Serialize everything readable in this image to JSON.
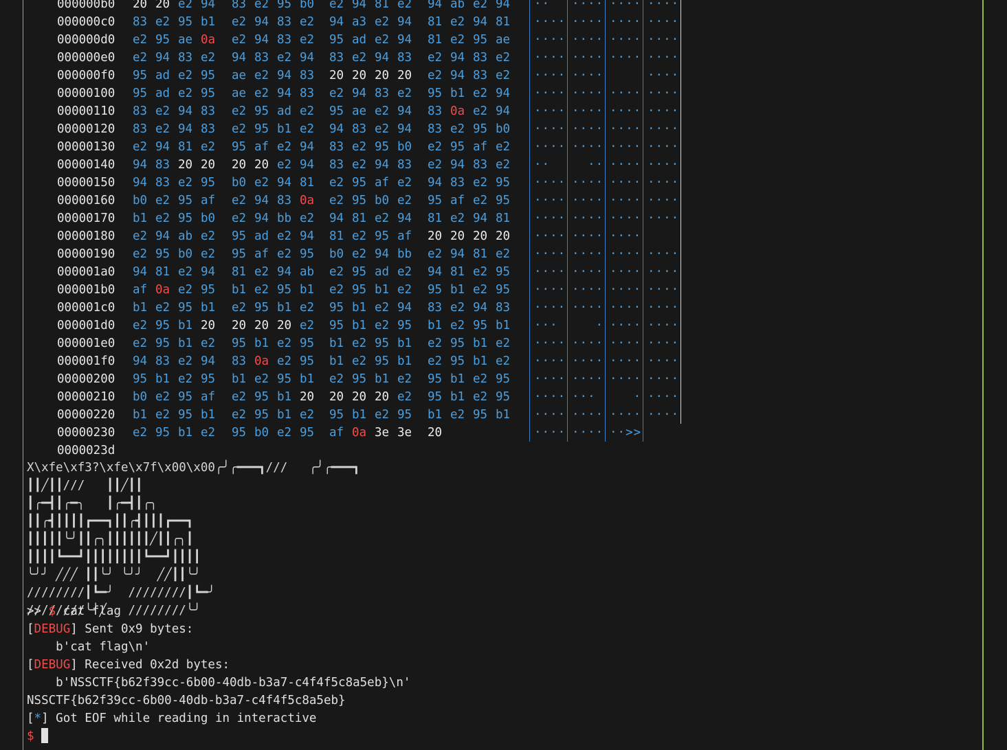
{
  "hexdump": {
    "rows": [
      {
        "offset": "000000b0",
        "bytes": [
          "20",
          "20",
          "e2",
          "94",
          "83",
          "e2",
          "95",
          "b0",
          "e2",
          "94",
          "81",
          "e2",
          "94",
          "ab",
          "e2",
          "94"
        ],
        "ascii": [
          "··",
          "····",
          "····",
          "····"
        ]
      },
      {
        "offset": "000000c0",
        "bytes": [
          "83",
          "e2",
          "95",
          "b1",
          "e2",
          "94",
          "83",
          "e2",
          "94",
          "a3",
          "e2",
          "94",
          "81",
          "e2",
          "94",
          "81"
        ],
        "ascii": [
          "····",
          "····",
          "····",
          "····"
        ]
      },
      {
        "offset": "000000d0",
        "bytes": [
          "e2",
          "95",
          "ae",
          "0a",
          "e2",
          "94",
          "83",
          "e2",
          "95",
          "ad",
          "e2",
          "94",
          "81",
          "e2",
          "95",
          "ae"
        ],
        "ascii": [
          "····",
          "····",
          "····",
          "····"
        ]
      },
      {
        "offset": "000000e0",
        "bytes": [
          "e2",
          "94",
          "83",
          "e2",
          "94",
          "83",
          "e2",
          "94",
          "83",
          "e2",
          "94",
          "83",
          "e2",
          "94",
          "83",
          "e2"
        ],
        "ascii": [
          "····",
          "····",
          "····",
          "····"
        ]
      },
      {
        "offset": "000000f0",
        "bytes": [
          "95",
          "ad",
          "e2",
          "95",
          "ae",
          "e2",
          "94",
          "83",
          "20",
          "20",
          "20",
          "20",
          "e2",
          "94",
          "83",
          "e2"
        ],
        "ascii": [
          "····",
          "····",
          "    ",
          "····"
        ]
      },
      {
        "offset": "00000100",
        "bytes": [
          "95",
          "ad",
          "e2",
          "95",
          "ae",
          "e2",
          "94",
          "83",
          "e2",
          "94",
          "83",
          "e2",
          "95",
          "b1",
          "e2",
          "94"
        ],
        "ascii": [
          "····",
          "····",
          "····",
          "····"
        ]
      },
      {
        "offset": "00000110",
        "bytes": [
          "83",
          "e2",
          "94",
          "83",
          "e2",
          "95",
          "ad",
          "e2",
          "95",
          "ae",
          "e2",
          "94",
          "83",
          "0a",
          "e2",
          "94"
        ],
        "ascii": [
          "····",
          "····",
          "····",
          "····"
        ]
      },
      {
        "offset": "00000120",
        "bytes": [
          "83",
          "e2",
          "94",
          "83",
          "e2",
          "95",
          "b1",
          "e2",
          "94",
          "83",
          "e2",
          "94",
          "83",
          "e2",
          "95",
          "b0"
        ],
        "ascii": [
          "····",
          "····",
          "····",
          "····"
        ]
      },
      {
        "offset": "00000130",
        "bytes": [
          "e2",
          "94",
          "81",
          "e2",
          "95",
          "af",
          "e2",
          "94",
          "83",
          "e2",
          "95",
          "b0",
          "e2",
          "95",
          "af",
          "e2"
        ],
        "ascii": [
          "····",
          "····",
          "····",
          "····"
        ]
      },
      {
        "offset": "00000140",
        "bytes": [
          "94",
          "83",
          "20",
          "20",
          "20",
          "20",
          "e2",
          "94",
          "83",
          "e2",
          "94",
          "83",
          "e2",
          "94",
          "83",
          "e2"
        ],
        "ascii": [
          "··  ",
          "  ··",
          "····",
          "····"
        ]
      },
      {
        "offset": "00000150",
        "bytes": [
          "94",
          "83",
          "e2",
          "95",
          "b0",
          "e2",
          "94",
          "81",
          "e2",
          "95",
          "af",
          "e2",
          "94",
          "83",
          "e2",
          "95"
        ],
        "ascii": [
          "····",
          "····",
          "····",
          "····"
        ]
      },
      {
        "offset": "00000160",
        "bytes": [
          "b0",
          "e2",
          "95",
          "af",
          "e2",
          "94",
          "83",
          "0a",
          "e2",
          "95",
          "b0",
          "e2",
          "95",
          "af",
          "e2",
          "95"
        ],
        "ascii": [
          "····",
          "····",
          "····",
          "····"
        ]
      },
      {
        "offset": "00000170",
        "bytes": [
          "b1",
          "e2",
          "95",
          "b0",
          "e2",
          "94",
          "bb",
          "e2",
          "94",
          "81",
          "e2",
          "94",
          "81",
          "e2",
          "94",
          "81"
        ],
        "ascii": [
          "····",
          "····",
          "····",
          "····"
        ]
      },
      {
        "offset": "00000180",
        "bytes": [
          "e2",
          "94",
          "ab",
          "e2",
          "95",
          "ad",
          "e2",
          "94",
          "81",
          "e2",
          "95",
          "af",
          "20",
          "20",
          "20",
          "20"
        ],
        "ascii": [
          "····",
          "····",
          "····",
          "    "
        ]
      },
      {
        "offset": "00000190",
        "bytes": [
          "e2",
          "95",
          "b0",
          "e2",
          "95",
          "af",
          "e2",
          "95",
          "b0",
          "e2",
          "94",
          "bb",
          "e2",
          "94",
          "81",
          "e2"
        ],
        "ascii": [
          "····",
          "····",
          "····",
          "····"
        ]
      },
      {
        "offset": "000001a0",
        "bytes": [
          "94",
          "81",
          "e2",
          "94",
          "81",
          "e2",
          "94",
          "ab",
          "e2",
          "95",
          "ad",
          "e2",
          "94",
          "81",
          "e2",
          "95"
        ],
        "ascii": [
          "····",
          "····",
          "····",
          "····"
        ]
      },
      {
        "offset": "000001b0",
        "bytes": [
          "af",
          "0a",
          "e2",
          "95",
          "b1",
          "e2",
          "95",
          "b1",
          "e2",
          "95",
          "b1",
          "e2",
          "95",
          "b1",
          "e2",
          "95"
        ],
        "ascii": [
          "····",
          "····",
          "····",
          "····"
        ]
      },
      {
        "offset": "000001c0",
        "bytes": [
          "b1",
          "e2",
          "95",
          "b1",
          "e2",
          "95",
          "b1",
          "e2",
          "95",
          "b1",
          "e2",
          "94",
          "83",
          "e2",
          "94",
          "83"
        ],
        "ascii": [
          "····",
          "····",
          "····",
          "····"
        ]
      },
      {
        "offset": "000001d0",
        "bytes": [
          "e2",
          "95",
          "b1",
          "20",
          "20",
          "20",
          "20",
          "e2",
          "95",
          "b1",
          "e2",
          "95",
          "b1",
          "e2",
          "95",
          "b1"
        ],
        "ascii": [
          "··· ",
          "   ·",
          "····",
          "····"
        ]
      },
      {
        "offset": "000001e0",
        "bytes": [
          "e2",
          "95",
          "b1",
          "e2",
          "95",
          "b1",
          "e2",
          "95",
          "b1",
          "e2",
          "95",
          "b1",
          "e2",
          "95",
          "b1",
          "e2"
        ],
        "ascii": [
          "····",
          "····",
          "····",
          "····"
        ]
      },
      {
        "offset": "000001f0",
        "bytes": [
          "94",
          "83",
          "e2",
          "94",
          "83",
          "0a",
          "e2",
          "95",
          "b1",
          "e2",
          "95",
          "b1",
          "e2",
          "95",
          "b1",
          "e2"
        ],
        "ascii": [
          "····",
          "····",
          "····",
          "····"
        ]
      },
      {
        "offset": "00000200",
        "bytes": [
          "95",
          "b1",
          "e2",
          "95",
          "b1",
          "e2",
          "95",
          "b1",
          "e2",
          "95",
          "b1",
          "e2",
          "95",
          "b1",
          "e2",
          "95"
        ],
        "ascii": [
          "····",
          "····",
          "····",
          "····"
        ]
      },
      {
        "offset": "00000210",
        "bytes": [
          "b0",
          "e2",
          "95",
          "af",
          "e2",
          "95",
          "b1",
          "20",
          "20",
          "20",
          "20",
          "e2",
          "95",
          "b1",
          "e2",
          "95"
        ],
        "ascii": [
          "····",
          "··· ",
          "   ·",
          "····"
        ]
      },
      {
        "offset": "00000220",
        "bytes": [
          "b1",
          "e2",
          "95",
          "b1",
          "e2",
          "95",
          "b1",
          "e2",
          "95",
          "b1",
          "e2",
          "95",
          "b1",
          "e2",
          "95",
          "b1"
        ],
        "ascii": [
          "····",
          "····",
          "····",
          "····"
        ]
      },
      {
        "offset": "00000230",
        "bytes": [
          "e2",
          "95",
          "b1",
          "e2",
          "95",
          "b0",
          "e2",
          "95",
          "af",
          "0a",
          "3e",
          "3e",
          "20",
          "",
          "",
          ""
        ],
        "ascii": [
          "····",
          "····",
          "··>>",
          " "
        ]
      }
    ],
    "end_offset": "0000023d"
  },
  "ascii_art": "X\\xfe\\xf3?\\xfe\\x7f\\x00\\x00╭╯╭━━━┓///   ╭╯╭━━━┓\n┃┃╱┃┃///   ┃┃╱┃┃\n┃╭━┫┃╭━╮   ┃╭━┫┃╭╮\n┃┃╭┫┃┃┃┃┏━━┓┃┃╭┫┃┃┃┏━━┓\n┃┃┃┃┃╰╯┃┃╭╮┃┃┃┃┃┃╱┃┃╭╮┃\n┃┃┃┃┗━━┛┃┃┃┃┃┃┃┃┗━━┛┃┃┃┃\n╰╯╯ ╱╱╱ ┃┃╰╯ ╰╯╯  ╱╱┃┃╰╯\n////////┃┗━╯  ////////┃┗━╯\n////////╰╯╱   ////////╰╯",
  "terminal": {
    "prompt_arrows": ">> ",
    "prompt_dollar": "$",
    "command": " cat flag",
    "debug_tag": "DEBUG",
    "sent_text": "] Sent 0x9 bytes:",
    "sent_payload": "    b'cat flag\\n'",
    "received_text": "] Received 0x2d bytes:",
    "received_payload": "    b'NSSCTF{b62f39cc-6b00-40db-b3a7-c4f4f5c8a5eb}\\n'",
    "flag": "NSSCTF{b62f39cc-6b00-40db-b3a7-c4f4f5c8a5eb}",
    "eof_star": "*",
    "eof_text": "] Got EOF while reading in interactive",
    "final_prompt": "$"
  },
  "colors": {
    "background": "#181818",
    "hex_byte": "#4a9fe0",
    "space_byte": "#ececec",
    "newline_byte": "#f14c4c",
    "debug": "#f14c4c",
    "border": "#8fbc3a"
  }
}
